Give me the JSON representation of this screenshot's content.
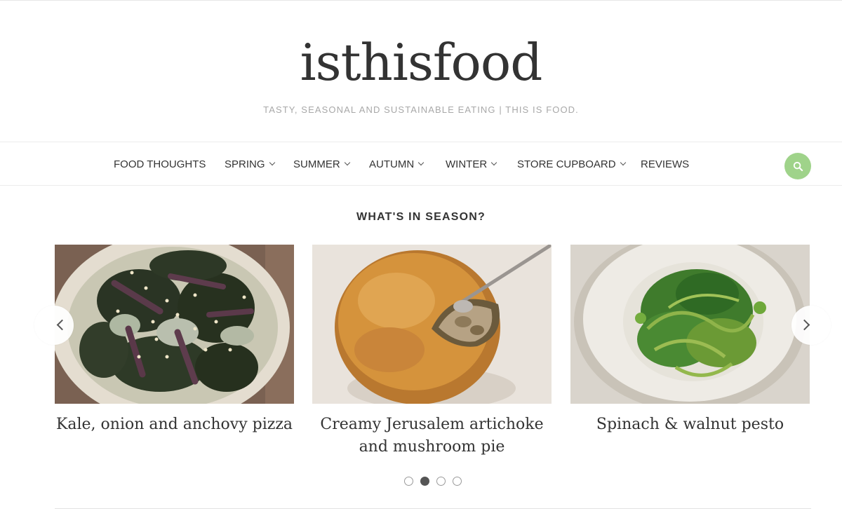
{
  "site": {
    "title": "isthisfood",
    "tagline": "TASTY, SEASONAL AND SUSTAINABLE EATING | THIS IS FOOD."
  },
  "nav": {
    "items": [
      {
        "label": "FOOD THOUGHTS",
        "has_dropdown": false
      },
      {
        "label": "SPRING",
        "has_dropdown": true
      },
      {
        "label": "SUMMER",
        "has_dropdown": true
      },
      {
        "label": "AUTUMN",
        "has_dropdown": true
      },
      {
        "label": "WINTER",
        "has_dropdown": true
      },
      {
        "label": "STORE CUPBOARD",
        "has_dropdown": true
      },
      {
        "label": "REVIEWS",
        "has_dropdown": false
      }
    ],
    "search_icon": "search-icon",
    "accent_color": "#9fd38a"
  },
  "section": {
    "title": "WHAT'S IN SEASON?"
  },
  "carousel": {
    "cards": [
      {
        "title": "Kale, onion and anchovy pizza",
        "image": "pizza-photo"
      },
      {
        "title": "Creamy Jerusalem artichoke and mushroom pie",
        "image": "pie-photo"
      },
      {
        "title": "Spinach & walnut pesto",
        "image": "pesto-photo"
      }
    ],
    "prev_icon": "chevron-left-icon",
    "next_icon": "chevron-right-icon",
    "page_count": 4,
    "active_page": 2
  }
}
